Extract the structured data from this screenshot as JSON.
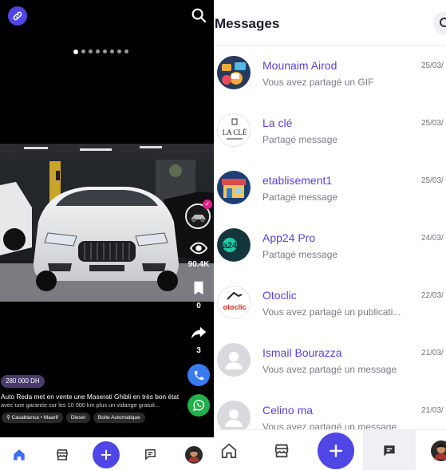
{
  "feed": {
    "price": "280 000 DH",
    "description_line1": "Auto Reda met en vente une Maserati Ghibli en très bon état",
    "description_line2": "avec une garantie sur les 10 000 km plus un vidange gratuit...",
    "tags": [
      "Casablanca • Maarif",
      "Diesel",
      "Boite Automatique"
    ],
    "carousel": {
      "count": 8,
      "active_index": 0
    },
    "views": "90.4K",
    "saves": "0",
    "shares": "3",
    "colors": {
      "accent": "#4f46e5",
      "call": "#3a7bf0",
      "whatsapp": "#22b04b",
      "price_bg": "#4a3a6a"
    }
  },
  "messages": {
    "title": "Messages",
    "conversations": [
      {
        "name": "Mounaim Airod",
        "last": "Vous avez partagé un GIF",
        "date": "25/03/",
        "avatar": "chat-illustration"
      },
      {
        "name": "La clé",
        "last": "Partagé message",
        "date": "25/03/",
        "avatar": "la-cle-logo"
      },
      {
        "name": "etablisement1",
        "last": "Partagé message",
        "date": "25/03/",
        "avatar": "shopfront-illustration"
      },
      {
        "name": "App24 Pro",
        "last": "Partagé message",
        "date": "24/03/",
        "avatar": "app24-logo"
      },
      {
        "name": "Otoclic",
        "last": "Vous avez partagé un publicati...",
        "date": "22/03/",
        "avatar": "otoclic-logo"
      },
      {
        "name": "Ismail Bourazza",
        "last": "Vous avez partagé un message",
        "date": "21/03/",
        "avatar": "default-user"
      },
      {
        "name": "Celino ma",
        "last": "Vous avez partagé un message",
        "date": "21/03/",
        "avatar": "default-user"
      }
    ],
    "colors": {
      "name": "#5b40d8",
      "fab": "#4f46e5"
    }
  },
  "logos": {
    "la_cle": "LA CLÉ",
    "app24": "a24",
    "otoclic": "otoclic"
  }
}
